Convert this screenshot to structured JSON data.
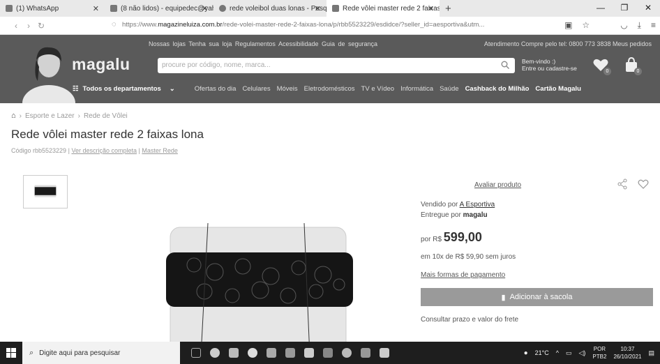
{
  "browser": {
    "tabs": [
      {
        "title": "(1) WhatsApp"
      },
      {
        "title": "(8 não lidos) - equipedec@yah"
      },
      {
        "title": "rede voleibol duas lonas - Pesq"
      },
      {
        "title": "Rede vôlei master rede 2 faixas",
        "active": true
      }
    ],
    "url_prefix": "https://www.",
    "url_domain": "magazineluiza.com.br",
    "url_path": "/rede-volei-master-rede-2-faixas-lona/p/rbb5523229/esdidce/?seller_id=aesportiva&utm..."
  },
  "header": {
    "top_links": "Nossas lojas  Tenha sua loja  Regulamentos  Acessibilidade  Guia de segurança",
    "top_right": "Atendimento  Compre pelo tel: 0800 773 3838  Meus pedidos",
    "logo": "magalu",
    "search_placeholder": "procure por código, nome, marca...",
    "login_line1": "Bem-vindo :)",
    "login_line2": "Entre ou cadastre-se",
    "wishlist_badge": "0",
    "cart_badge": "0",
    "departments": "Todos os departamentos",
    "nav_items": [
      "Ofertas do dia",
      "Celulares",
      "Móveis",
      "Eletrodomésticos",
      "TV e Vídeo",
      "Informática",
      "Saúde"
    ],
    "nav_strong": [
      "Cashback do Milhão",
      "Cartão Magalu"
    ]
  },
  "breadcrumb": [
    "Esporte e Lazer",
    "Rede de Vôlei"
  ],
  "product": {
    "title": "Rede vôlei master rede 2 faixas lona",
    "code": "Código rbb5523229",
    "description_link": "Ver descrição completa",
    "brand": "Master Rede"
  },
  "buybox": {
    "rate": "Avaliar produto",
    "sold_by_label": "Vendido por",
    "seller": "A Esportiva",
    "delivered_label": "Entregue por",
    "delivered_by": "magalu",
    "price_prefix": "por R$",
    "price": "599,00",
    "installments": "em 10x de R$ 59,90 sem juros",
    "payment_link": "Mais formas de pagamento",
    "add_to_cart": "Adicionar à sacola",
    "shipping": "Consultar prazo e valor do frete"
  },
  "taskbar": {
    "search_placeholder": "Digite aqui para pesquisar",
    "weather": "21°C",
    "lang": "POR",
    "layout": "PTB2",
    "time": "10:37",
    "date": "26/10/2021"
  }
}
